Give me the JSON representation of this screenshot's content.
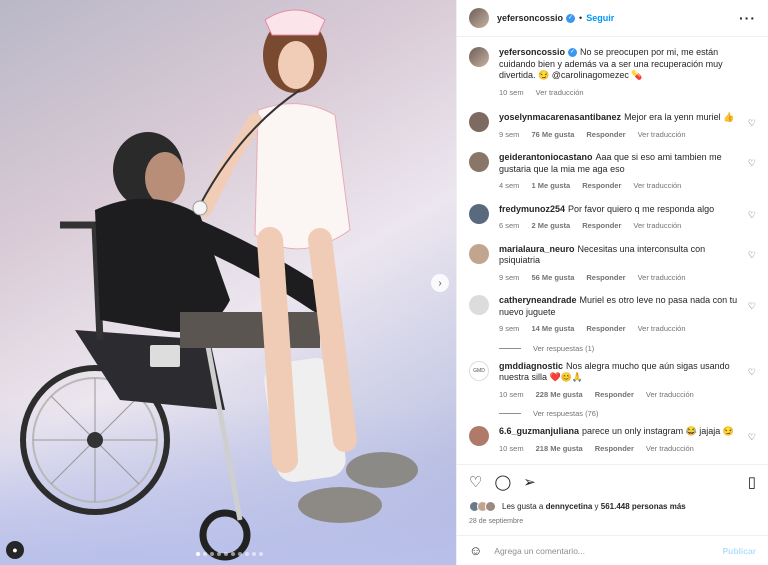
{
  "post": {
    "username": "yefersoncossio",
    "follow_label": "Seguir",
    "more_icon": "more-options-icon",
    "caption": "No se preocupen por mi, me están cuidando bien y además va a ser una recuperación muy divertida. 😏 @carolinagomezec 💊",
    "caption_time": "10 sem",
    "caption_translate": "Ver traducción"
  },
  "comments": [
    {
      "user": "yoselynmacarenasantibanez",
      "text": "Mejor era la yenn muriel 👍",
      "time": "9 sem",
      "likes": "76 Me gusta",
      "reply": "Responder",
      "translate": "Ver traducción"
    },
    {
      "user": "geiderantoniocastano",
      "text": "Aaa que si eso ami tambien me gustaria que la mia me aga eso",
      "time": "4 sem",
      "likes": "1 Me gusta",
      "reply": "Responder",
      "translate": "Ver traducción"
    },
    {
      "user": "fredymunoz254",
      "text": "Por favor quiero q me responda algo",
      "time": "6 sem",
      "likes": "2 Me gusta",
      "reply": "Responder",
      "translate": "Ver traducción"
    },
    {
      "user": "marialaura_neuro",
      "text": "Necesitas una interconsulta con psiquiatria",
      "time": "9 sem",
      "likes": "56 Me gusta",
      "reply": "Responder",
      "translate": "Ver traducción"
    },
    {
      "user": "catheryneandrade",
      "text": "Muriel es otro leve no pasa nada con tu nuevo juguete",
      "time": "9 sem",
      "likes": "14 Me gusta",
      "reply": "Responder",
      "translate": "Ver traducción",
      "replies": "Ver respuestas (1)"
    },
    {
      "user": "gmddiagnostic",
      "text": "Nos alegra mucho que aún sigas usando nuestra silla ❤️😊🙏",
      "time": "10 sem",
      "likes": "228 Me gusta",
      "reply": "Responder",
      "translate": "Ver traducción",
      "replies": "Ver respuestas (76)",
      "avatar_text": "GMD"
    },
    {
      "user": "6.6_guzmanjuliana",
      "text": "parece un only instagram 😂 jajaja 😏",
      "time": "10 sem",
      "likes": "218 Me gusta",
      "reply": "Responder",
      "translate": "Ver traducción"
    }
  ],
  "likes": {
    "prefix": "Les gusta a",
    "user": "dennycetina",
    "middle": "y",
    "count": "561.448 personas más"
  },
  "date": "28 de septiembre",
  "add_comment": {
    "placeholder": "Agrega un comentario...",
    "publish": "Publicar"
  },
  "colors": {
    "accent": "#0095f6",
    "verified": "#3897f0",
    "publish_disabled": "#b2dffc"
  },
  "carousel": {
    "total": 10,
    "active": 1
  }
}
